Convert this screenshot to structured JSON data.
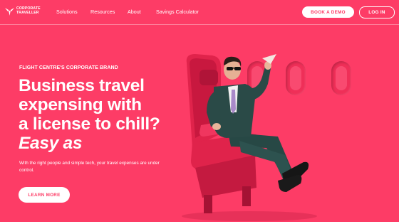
{
  "brand": {
    "logo_line1": "CORPORATE",
    "logo_line2": "TRAVELLER"
  },
  "nav": {
    "items": [
      "Solutions",
      "Resources",
      "About",
      "Savings Calculator"
    ]
  },
  "header": {
    "book_demo": "BOOK A DEMO",
    "login": "LOG IN"
  },
  "hero": {
    "eyebrow": "FLIGHT CENTRE'S CORPORATE BRAND",
    "headline_lines": [
      "Business travel",
      "expensing with",
      "a license to chill?"
    ],
    "headline_emphasis": "Easy as",
    "subtext": "With the right people and simple tech, your travel expenses are under control.",
    "cta": "LEARN MORE"
  },
  "colors": {
    "brand": "#fd3c66",
    "white": "#ffffff"
  },
  "icons": {
    "logo": "airplane-wing-logo"
  }
}
